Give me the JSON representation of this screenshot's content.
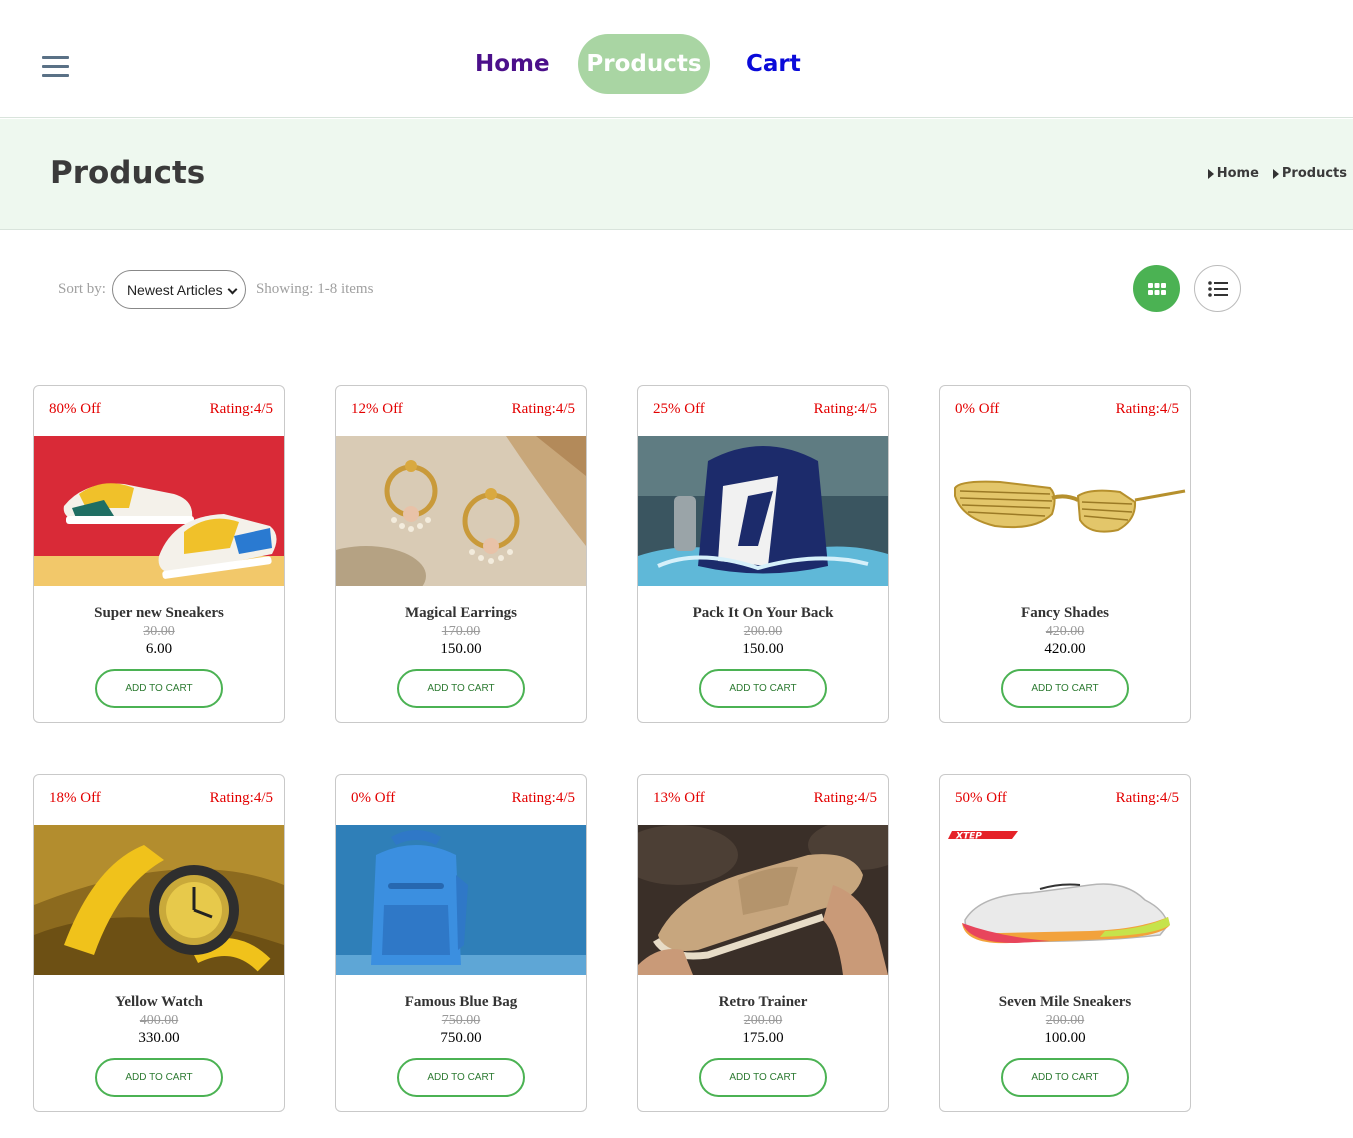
{
  "nav": {
    "menu_icon": "hamburger-menu-icon",
    "links": [
      "Home",
      "Products",
      "Cart"
    ],
    "active": "Products",
    "active_color": "#a9d5a3"
  },
  "header": {
    "title": "Products",
    "breadcrumb": [
      "Home",
      "Products"
    ]
  },
  "toolbar": {
    "sort_label": "Sort by:",
    "sort_value": "Newest Articles",
    "showing": "Showing: 1-8 items",
    "grid_view_icon": "grid-view-icon",
    "list_view_icon": "list-view-icon",
    "active_view": "grid",
    "accent": "#4bb253"
  },
  "products": [
    {
      "discount": "80% Off",
      "rating": "Rating:4/5",
      "name": "Super new Sneakers",
      "old_price": "30.00",
      "price": "6.00",
      "cta": "ADD TO CART",
      "image": "sneakers-photo"
    },
    {
      "discount": "12% Off",
      "rating": "Rating:4/5",
      "name": "Magical Earrings",
      "old_price": "170.00",
      "price": "150.00",
      "cta": "ADD TO CART",
      "image": "earrings-photo"
    },
    {
      "discount": "25% Off",
      "rating": "Rating:4/5",
      "name": "Pack It On Your Back",
      "old_price": "200.00",
      "price": "150.00",
      "cta": "ADD TO CART",
      "image": "backpack-photo"
    },
    {
      "discount": "0% Off",
      "rating": "Rating:4/5",
      "name": "Fancy Shades",
      "old_price": "420.00",
      "price": "420.00",
      "cta": "ADD TO CART",
      "image": "shutter-shades-photo"
    },
    {
      "discount": "18% Off",
      "rating": "Rating:4/5",
      "name": "Yellow Watch",
      "old_price": "400.00",
      "price": "330.00",
      "cta": "ADD TO CART",
      "image": "yellow-watch-photo"
    },
    {
      "discount": "0% Off",
      "rating": "Rating:4/5",
      "name": "Famous Blue Bag",
      "old_price": "750.00",
      "price": "750.00",
      "cta": "ADD TO CART",
      "image": "blue-bag-photo"
    },
    {
      "discount": "13% Off",
      "rating": "Rating:4/5",
      "name": "Retro Trainer",
      "old_price": "200.00",
      "price": "175.00",
      "cta": "ADD TO CART",
      "image": "retro-trainer-photo"
    },
    {
      "discount": "50% Off",
      "rating": "Rating:4/5",
      "name": "Seven Mile Sneakers",
      "old_price": "200.00",
      "price": "100.00",
      "cta": "ADD TO CART",
      "image": "running-shoe-photo",
      "brand_logo": "XTEP"
    }
  ],
  "colors": {
    "discount_text": "#e30000",
    "header_band": "#eef8ef",
    "cta_border": "#4bb253"
  }
}
